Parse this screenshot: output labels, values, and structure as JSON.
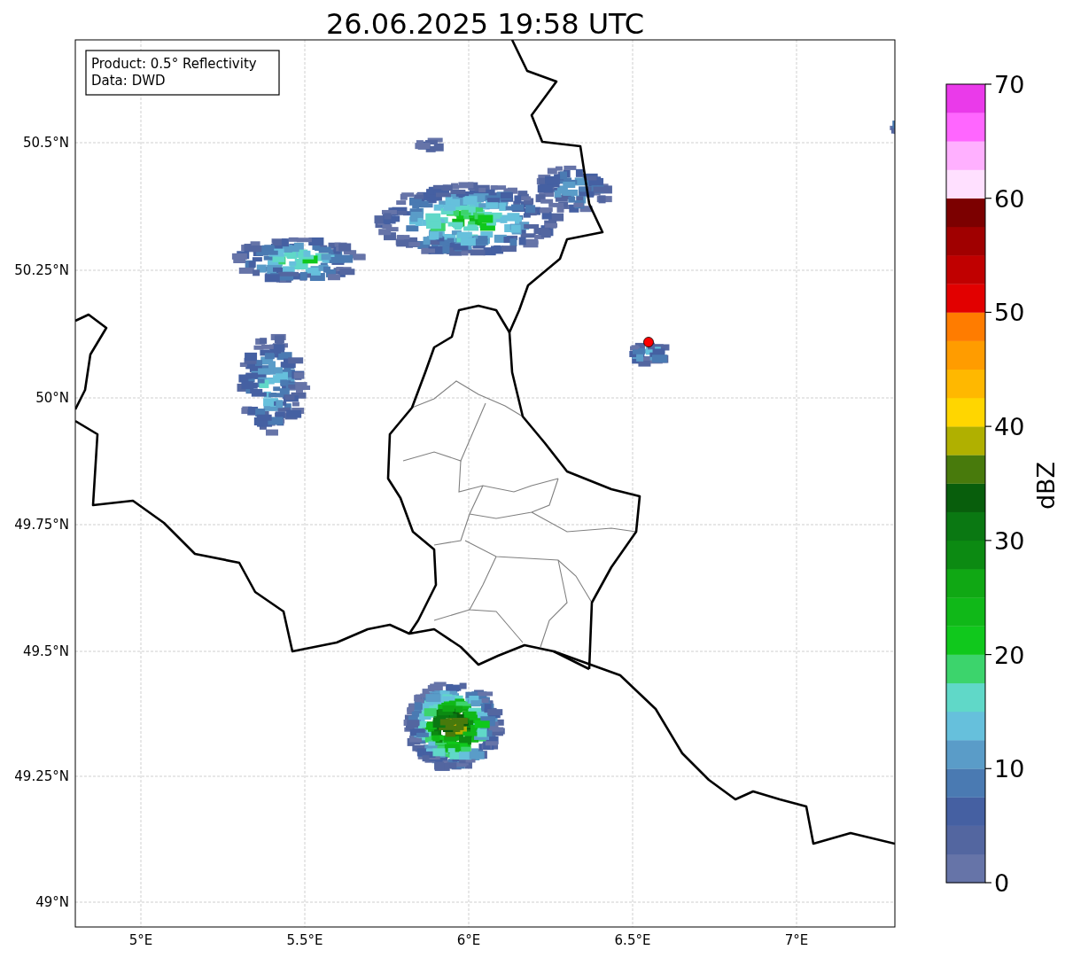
{
  "title": "26.06.2025 19:58 UTC",
  "info_box": [
    "Product: 0.5° Reflectivity",
    "Data: DWD"
  ],
  "map": {
    "lat_ticks": [
      "50.5°N",
      "50.25°N",
      "50°N",
      "49.75°N",
      "49.5°N",
      "49.25°N",
      "49°N"
    ],
    "lon_ticks": [
      "5°E",
      "5.5°E",
      "6°E",
      "6.5°E",
      "7°E"
    ]
  },
  "colorbar": {
    "label": "dBZ",
    "ticks": [
      "70",
      "60",
      "50",
      "40",
      "30",
      "20",
      "10",
      "0"
    ],
    "bins": [
      {
        "color": "#6674a8"
      },
      {
        "color": "#5366a0"
      },
      {
        "color": "#4560a2"
      },
      {
        "color": "#4a7ab2"
      },
      {
        "color": "#5a9cc8"
      },
      {
        "color": "#66c0dc"
      },
      {
        "color": "#60d8c8"
      },
      {
        "color": "#3cd46c"
      },
      {
        "color": "#10c81c"
      },
      {
        "color": "#10b818"
      },
      {
        "color": "#10a814"
      },
      {
        "color": "#0c8a12"
      },
      {
        "color": "#0a7812"
      },
      {
        "color": "#085e0c"
      },
      {
        "color": "#487a0c"
      },
      {
        "color": "#b0b000"
      },
      {
        "color": "#ffd600"
      },
      {
        "color": "#ffb800"
      },
      {
        "color": "#ff9c00"
      },
      {
        "color": "#ff7c00"
      },
      {
        "color": "#e20000"
      },
      {
        "color": "#c00000"
      },
      {
        "color": "#a00000"
      },
      {
        "color": "#7c0000"
      },
      {
        "color": "#ffe0ff"
      },
      {
        "color": "#ffb0ff"
      },
      {
        "color": "#ff66ff"
      },
      {
        "color": "#ea3aea"
      }
    ]
  }
}
